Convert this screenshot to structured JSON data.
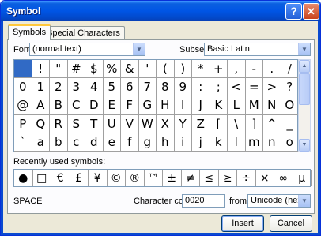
{
  "window": {
    "title": "Symbol"
  },
  "tabs": [
    "Symbols",
    "Special Characters"
  ],
  "font": {
    "label": "Font:",
    "value": "(normal text)"
  },
  "subset": {
    "label": "Subset:",
    "value": "Basic Latin"
  },
  "symbols": [
    [
      "",
      "!",
      "\"",
      "#",
      "$",
      "%",
      "&",
      "'",
      "(",
      ")",
      "*",
      "+",
      ",",
      "-",
      ".",
      "/"
    ],
    [
      "0",
      "1",
      "2",
      "3",
      "4",
      "5",
      "6",
      "7",
      "8",
      "9",
      ":",
      ";",
      "<",
      "=",
      ">",
      "?"
    ],
    [
      "@",
      "A",
      "B",
      "C",
      "D",
      "E",
      "F",
      "G",
      "H",
      "I",
      "J",
      "K",
      "L",
      "M",
      "N",
      "O"
    ],
    [
      "P",
      "Q",
      "R",
      "S",
      "T",
      "U",
      "V",
      "W",
      "X",
      "Y",
      "Z",
      "[",
      "\\",
      "]",
      "^",
      "_"
    ],
    [
      "`",
      "a",
      "b",
      "c",
      "d",
      "e",
      "f",
      "g",
      "h",
      "i",
      "j",
      "k",
      "l",
      "m",
      "n",
      "o"
    ]
  ],
  "selected_index": 0,
  "recently_used_label": "Recently used symbols:",
  "recent": [
    "●",
    "□",
    "€",
    "£",
    "¥",
    "©",
    "®",
    "™",
    "±",
    "≠",
    "≤",
    "≥",
    "÷",
    "×",
    "∞",
    "µ"
  ],
  "char_name": "SPACE",
  "char_code": {
    "label": "Character code:",
    "value": "0020"
  },
  "from": {
    "label": "from:",
    "value": "Unicode (hex)"
  },
  "buttons": {
    "insert": "Insert",
    "cancel": "Cancel"
  },
  "icons": {
    "help": "?",
    "close": "✕",
    "dropdown": "▼",
    "scroll_up": "▲",
    "scroll_down": "▼"
  },
  "colors": {
    "selection": "#316ac5",
    "titlebar": "#0055e5"
  }
}
